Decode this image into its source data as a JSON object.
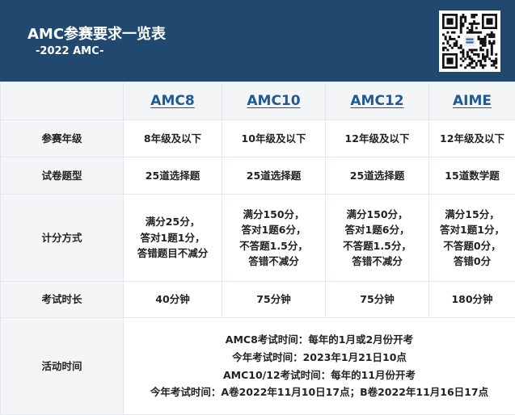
{
  "header": {
    "title": "AMC参赛要求一览表",
    "subtitle": "-2022 AMC-",
    "qr_label": "qr-code"
  },
  "columns": [
    "AMC8",
    "AMC10",
    "AMC12",
    "AIME"
  ],
  "rows": [
    {
      "label": "参赛年级",
      "cells": [
        "8年级及以下",
        "10年级及以下",
        "12年级及以下",
        "12年级及以下"
      ]
    },
    {
      "label": "试卷题型",
      "cells": [
        "25道选择题",
        "25道选择题",
        "25道选择题",
        "15道数学题"
      ]
    },
    {
      "label": "计分方式",
      "cells": [
        [
          "满分25分，",
          "答对1题1分，",
          "答错题目不减分"
        ],
        [
          "满分150分，",
          "答对1题6分，",
          "不答题1.5分，",
          "答错不减分"
        ],
        [
          "满分150分，",
          "答对1题6分，",
          "不答题1.5分，",
          "答错不减分"
        ],
        [
          "满分15分，",
          "答对1题1分，",
          "不答题0分，",
          "答错0分"
        ]
      ]
    },
    {
      "label": "考试时长",
      "cells": [
        "40分钟",
        "75分钟",
        "75分钟",
        "180分钟"
      ]
    }
  ],
  "activity": {
    "label": "活动时间",
    "lines": [
      "AMC8考试时间：每年的1月或2月份开考",
      "今年考试时间：2023年1月21日10点",
      "AMC10/12考试时间：每年的11月份开考",
      "今年考试时间：A卷2022年11月10日17点；B卷2022年11月16日17点"
    ]
  },
  "colors": {
    "header_bg": "#21496f",
    "column_text": "#1f5a95",
    "row_bg": "#f4f5f7"
  }
}
